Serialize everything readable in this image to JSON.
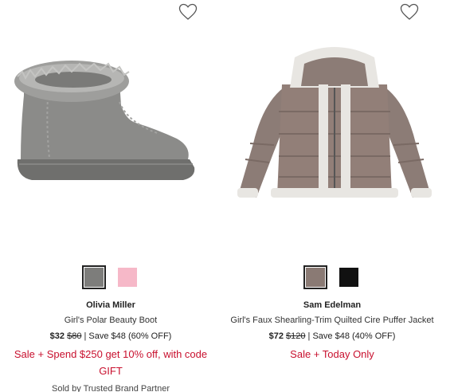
{
  "products": [
    {
      "brand": "Olivia Miller",
      "name": "Girl's Polar Beauty Boot",
      "price_sale": "$32",
      "price_original": "$80",
      "savings": " | Save $48 (60% OFF)",
      "promo": "Sale + Spend $250 get 10% off, with code GIFT",
      "seller": "Sold by Trusted Brand Partner",
      "swatches": [
        {
          "color": "#7d7d7b",
          "selected": true
        },
        {
          "color": "#f6b8c8",
          "selected": false
        }
      ],
      "icon": "heart-outline-icon"
    },
    {
      "brand": "Sam Edelman",
      "name": "Girl's Faux Shearling-Trim Quilted Cire Puffer Jacket",
      "price_sale": "$72",
      "price_original": "$120",
      "savings": " | Save $48 (40% OFF)",
      "promo": "Sale + Today Only",
      "swatches": [
        {
          "color": "#8a7a74",
          "selected": true
        },
        {
          "color": "#111111",
          "selected": false
        }
      ],
      "icon": "heart-outline-icon"
    }
  ],
  "colors": {
    "promo_red": "#c8102e",
    "text": "#1a1a1a"
  }
}
